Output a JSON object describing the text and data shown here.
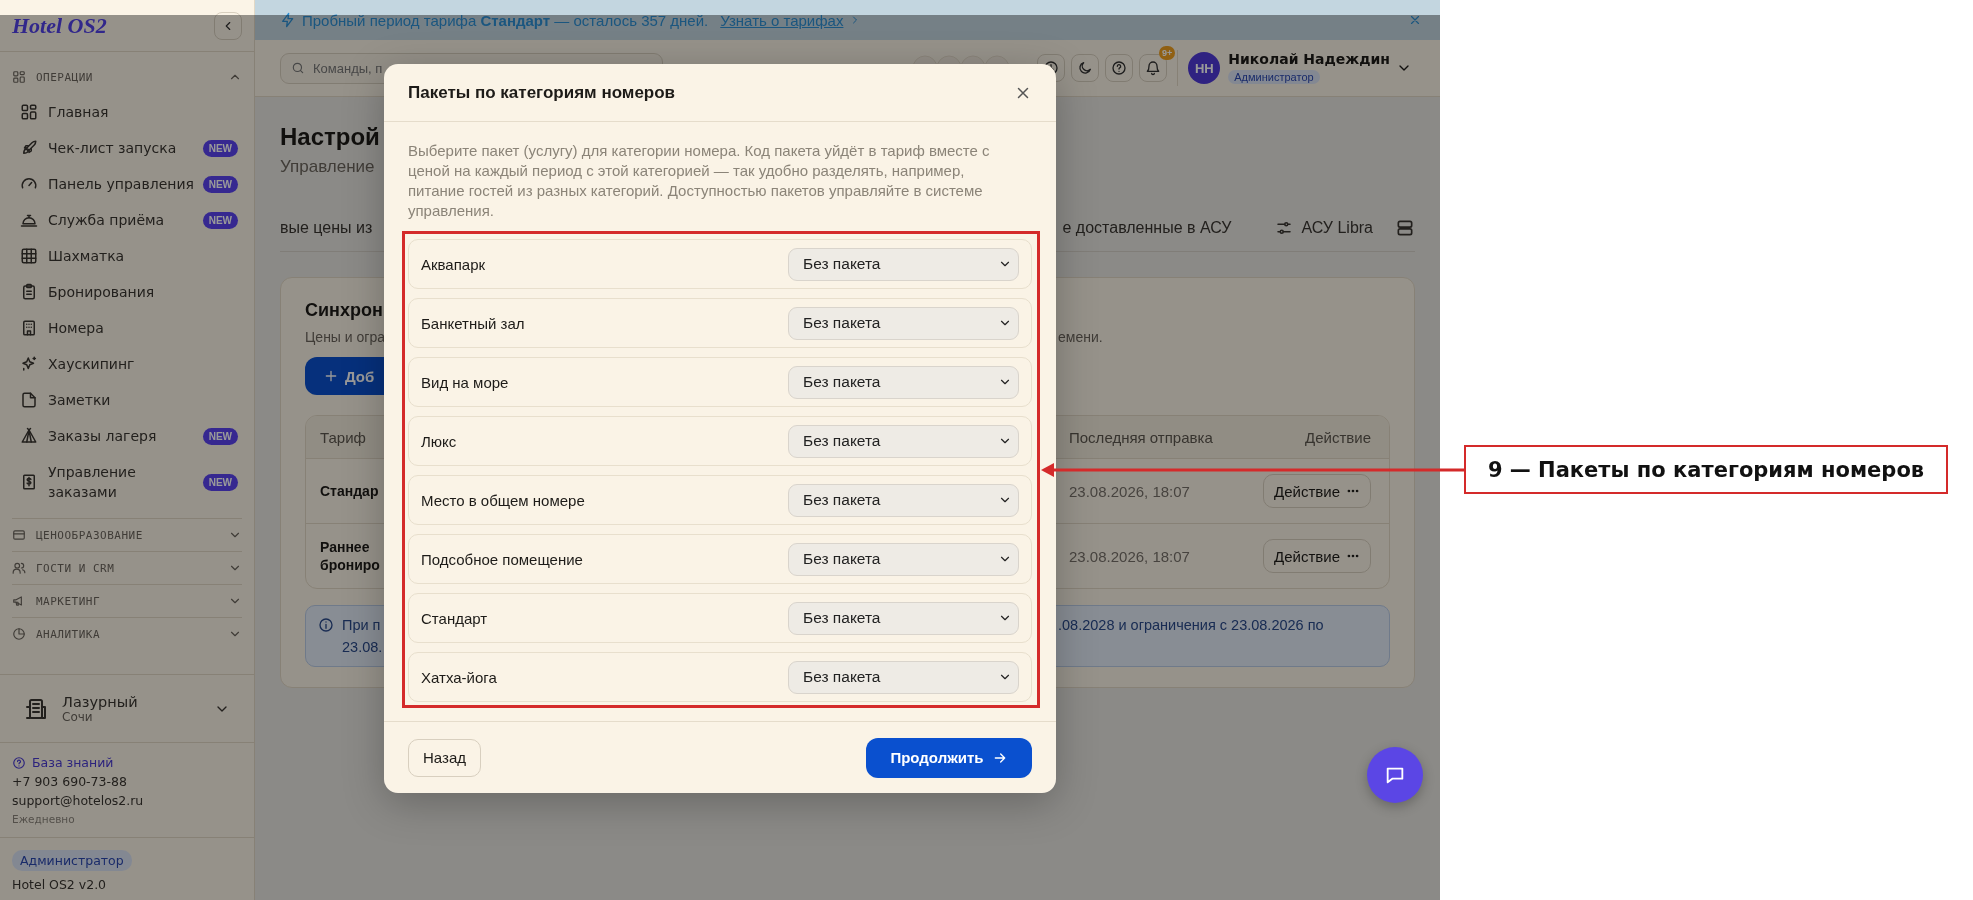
{
  "sidebar": {
    "logo": "Hotel OS2",
    "sections": [
      {
        "title": "ОПЕРАЦИИ",
        "expanded": true,
        "items": [
          {
            "label": "Главная"
          },
          {
            "label": "Чек-лист запуска",
            "badge": "NEW"
          },
          {
            "label": "Панель управления",
            "badge": "NEW"
          },
          {
            "label": "Служба приёма",
            "badge": "NEW"
          },
          {
            "label": "Шахматка"
          },
          {
            "label": "Бронирования"
          },
          {
            "label": "Номера"
          },
          {
            "label": "Хаускипинг"
          },
          {
            "label": "Заметки"
          },
          {
            "label": "Заказы лагеря",
            "badge": "NEW"
          },
          {
            "label": "Управление заказами",
            "badge": "NEW"
          }
        ]
      },
      {
        "title": "ЦЕНООБРАЗОВАНИЕ",
        "expanded": false
      },
      {
        "title": "ГОСТИ И CRM",
        "expanded": false
      },
      {
        "title": "МАРКЕТИНГ",
        "expanded": false
      },
      {
        "title": "АНАЛИТИКА",
        "expanded": false
      }
    ],
    "property": {
      "name": "Лазурный",
      "city": "Сочи"
    },
    "support": {
      "link": "База знаний",
      "phone": "+7 903 690-73-88",
      "email": "support@hotelos2.ru",
      "hours": "Ежедневно"
    },
    "role": "Администратор",
    "version": "Hotel OS2 v2.0"
  },
  "banner": {
    "text": "Пробный период тарифа **Стандарт** — осталось 357 дней.",
    "link": "Узнать о тарифах"
  },
  "topbar": {
    "search_placeholder": "Команды, п",
    "notification_count": "9+",
    "user": {
      "initials": "НН",
      "name": "Николай Надеждин",
      "role": "Администратор"
    }
  },
  "page": {
    "title": "Настрой",
    "subtitle": "Управление",
    "tabs": [
      {
        "label": "вые цены из"
      },
      {
        "label": "е доставленные в АСУ"
      },
      {
        "label": "АСУ Libra"
      }
    ],
    "card": {
      "title": "Синхрон",
      "description": "Цены и огра",
      "description_end": "емени.",
      "add_button": "Доб",
      "table": {
        "columns": [
          "Тариф",
          "Последняя отправка",
          "Действие"
        ],
        "rows": [
          {
            "tariff": "Стандар",
            "last_sent": "23.08.2026, 18:07",
            "action": "Действие"
          },
          {
            "tariff": "Раннее брониро",
            "last_sent": "23.08.2026, 18:07",
            "action": "Действие"
          }
        ]
      },
      "notice": {
        "text": "При п",
        "text_line_2": "23.08.",
        "text_end": ".08.2028 и ограничения с 23.08.2026 по"
      }
    }
  },
  "modal": {
    "title": "Пакеты по категориям номеров",
    "description": "Выберите пакет (услугу) для категории номера. Код пакета уйдёт в тариф вместе с ценой на каждый период с этой категорией — так удобно разделять, например, питание гостей из разных категорий. Доступностью пакетов управляйте в системе управления.",
    "categories": [
      {
        "name": "Аквапарк",
        "package": "Без пакета"
      },
      {
        "name": "Банкетный зал",
        "package": "Без пакета"
      },
      {
        "name": "Вид на море",
        "package": "Без пакета"
      },
      {
        "name": "Люкс",
        "package": "Без пакета"
      },
      {
        "name": "Место в общем номере",
        "package": "Без пакета"
      },
      {
        "name": "Подсобное помещение",
        "package": "Без пакета"
      },
      {
        "name": "Стандарт",
        "package": "Без пакета"
      },
      {
        "name": "Хатха-йога",
        "package": "Без пакета"
      }
    ],
    "back_button": "Назад",
    "continue_button": "Продолжить"
  },
  "callout": {
    "label": "9 — Пакеты по категориям номеров"
  }
}
